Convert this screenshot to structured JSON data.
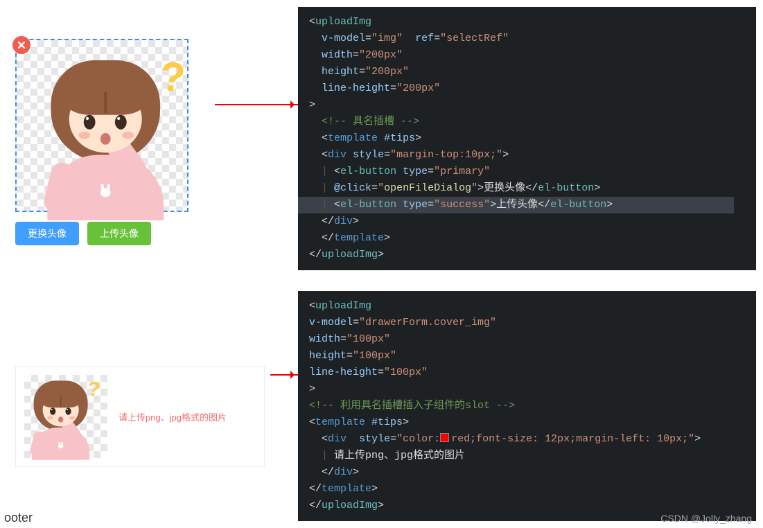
{
  "example1": {
    "change_btn": "更换头像",
    "upload_btn": "上传头像"
  },
  "example2": {
    "tip": "请上传png、jpg格式的图片"
  },
  "code1": {
    "l1_tag": "uploadImg",
    "l2_attr": "v-model",
    "l2_val": "\"img\"",
    "l2b_attr": "ref",
    "l2b_val": "\"selectRef\"",
    "l3_attr": "width",
    "l3_val": "\"200px\"",
    "l4_attr": "height",
    "l4_val": "\"200px\"",
    "l5_attr": "line-height",
    "l5_val": "\"200px\"",
    "l6": ">",
    "l7": "<!-- 具名插槽 -->",
    "l8_tag": "template",
    "l8_attr": "#tips",
    "l9_tag": "div",
    "l9_attr": "style",
    "l9_val": "\"margin-top:10px;\"",
    "l10_tag": "el-button",
    "l10_attr": "type",
    "l10_val": "\"primary\"",
    "l11_attr": "@click",
    "l11_val": "\"openFileDialog\"",
    "l11_txt": "更换头像",
    "l12_tag": "el-button",
    "l12_attr": "type",
    "l12_val": "\"success\"",
    "l12_txt": "上传头像",
    "l13_close_div": "div",
    "l14_close_tpl": "template",
    "l15_close": "uploadImg"
  },
  "code2": {
    "l1_tag": "uploadImg",
    "l2_attr": "v-model",
    "l2_val": "\"drawerForm.cover_img\"",
    "l3_attr": "width",
    "l3_val": "\"100px\"",
    "l4_attr": "height",
    "l4_val": "\"100px\"",
    "l5_attr": "line-height",
    "l5_val": "\"100px\"",
    "l6": ">",
    "l7": "<!-- 利用具名插槽插入子组件的slot -->",
    "l8_tag": "template",
    "l8_attr": "#tips",
    "l9_tag": "div",
    "l9_attr": "style",
    "l9_val_a": "\"color:",
    "l9_val_b": "red;font-size: 12px;margin-left: 10px;\"",
    "l10_txt": "请上传png、jpg格式的图片",
    "l11_close_div": "div",
    "l12_close_tpl": "template",
    "l13_close": "uploadImg"
  },
  "footer": "ooter",
  "watermark": "CSDN @Jolly_zhang"
}
